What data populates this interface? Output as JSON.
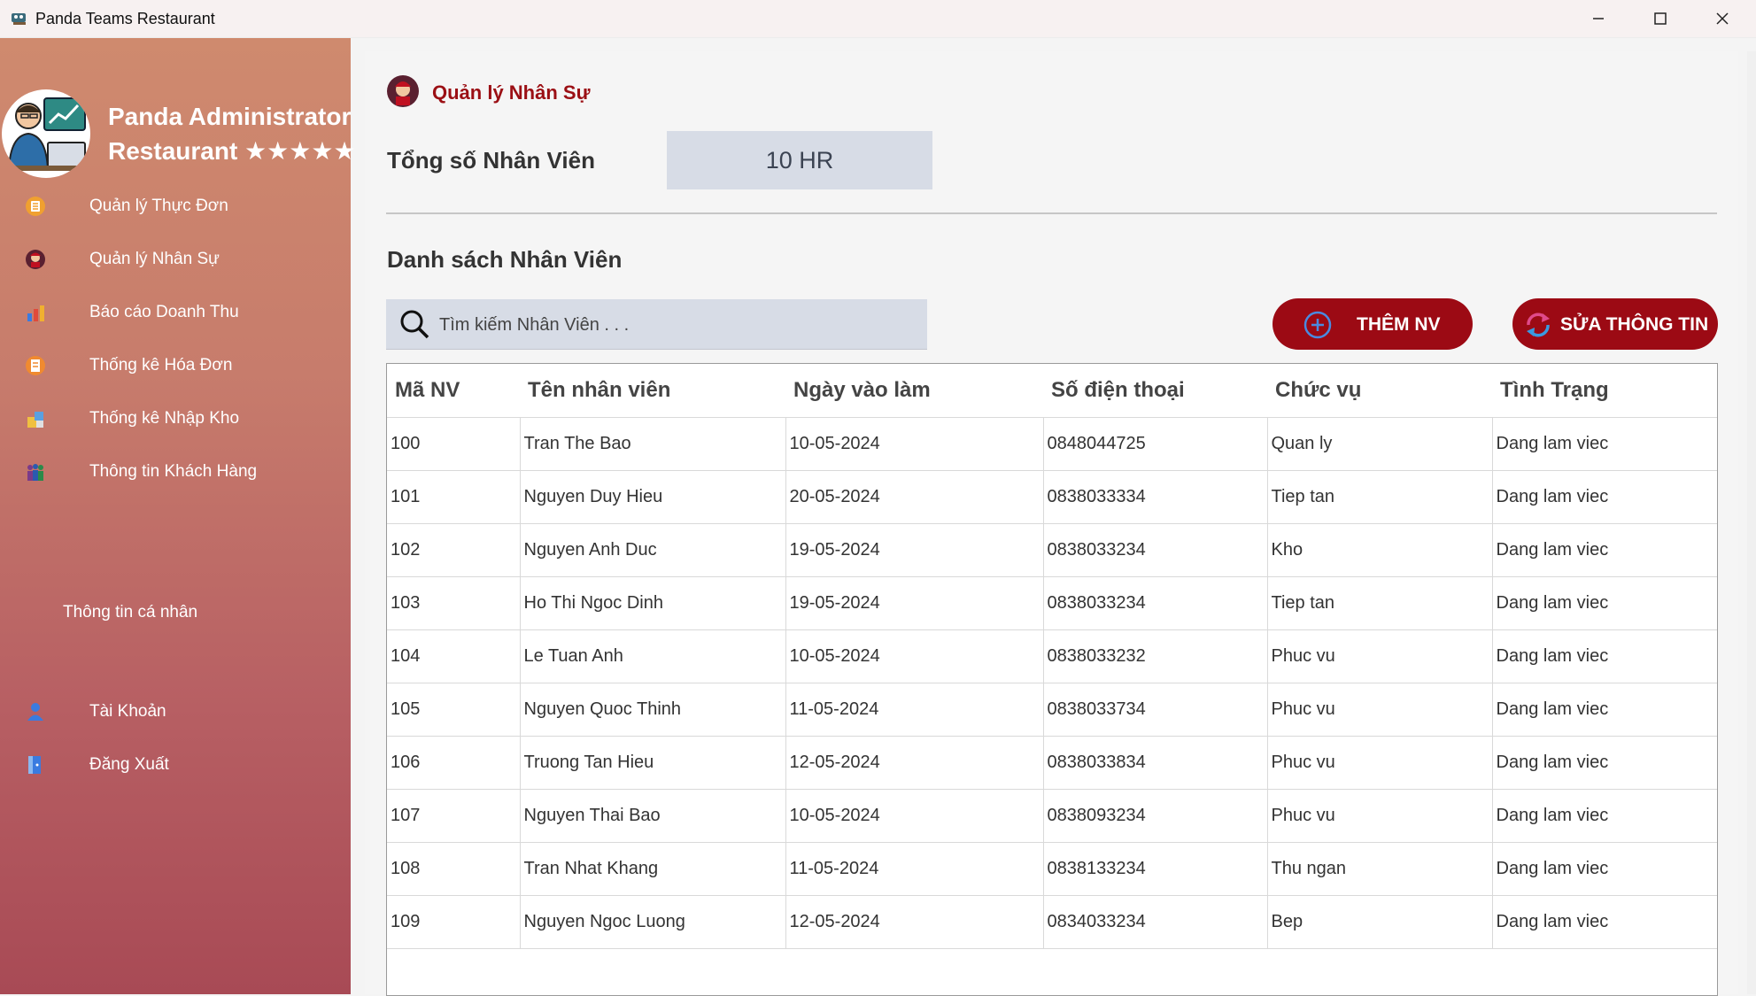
{
  "window": {
    "title": "Panda Teams Restaurant"
  },
  "sidebar": {
    "brand_line1": "Panda Administrator",
    "brand_line2": "Restaurant ★★★★★",
    "nav": [
      {
        "label": "Quản lý Thực Đơn",
        "icon": "menu-icon"
      },
      {
        "label": "Quản lý Nhân Sự",
        "icon": "staff-icon"
      },
      {
        "label": "Báo cáo Doanh Thu",
        "icon": "revenue-chart-icon"
      },
      {
        "label": "Thống kê Hóa Đơn",
        "icon": "invoice-icon"
      },
      {
        "label": "Thống kê Nhập Kho",
        "icon": "warehouse-icon"
      },
      {
        "label": "Thông tin Khách Hàng",
        "icon": "customers-icon"
      }
    ],
    "profile_label": "Thông tin cá nhân",
    "account": [
      {
        "label": "Tài Khoản",
        "icon": "user-icon"
      },
      {
        "label": "Đăng Xuất",
        "icon": "logout-icon"
      }
    ]
  },
  "main": {
    "page_title": "Quản lý Nhân Sự",
    "total_label": "Tổng số Nhân Viên",
    "total_value": "10 HR",
    "list_title": "Danh sách Nhân Viên",
    "search_placeholder": "Tìm kiếm Nhân Viên . . .",
    "add_button": "THÊM NV",
    "edit_button": "SỬA THÔNG TIN"
  },
  "table": {
    "columns": [
      "Mã NV",
      "Tên nhân viên",
      "Ngày vào làm",
      "Số điện thoại",
      "Chức vụ",
      "Tình Trạng"
    ],
    "rows": [
      [
        "100",
        "Tran The Bao",
        "10-05-2024",
        "0848044725",
        "Quan ly",
        "Dang lam viec"
      ],
      [
        "101",
        "Nguyen Duy Hieu",
        "20-05-2024",
        "0838033334",
        "Tiep tan",
        "Dang lam viec"
      ],
      [
        "102",
        "Nguyen Anh Duc",
        "19-05-2024",
        "0838033234",
        "Kho",
        "Dang lam viec"
      ],
      [
        "103",
        "Ho Thi Ngoc Dinh",
        "19-05-2024",
        "0838033234",
        "Tiep tan",
        "Dang lam viec"
      ],
      [
        "104",
        "Le Tuan Anh",
        "10-05-2024",
        "0838033232",
        "Phuc vu",
        "Dang lam viec"
      ],
      [
        "105",
        "Nguyen Quoc Thinh",
        "11-05-2024",
        "0838033734",
        "Phuc vu",
        "Dang lam viec"
      ],
      [
        "106",
        "Truong Tan Hieu",
        "12-05-2024",
        "0838033834",
        "Phuc vu",
        "Dang lam viec"
      ],
      [
        "107",
        "Nguyen Thai Bao",
        "10-05-2024",
        "0838093234",
        "Phuc vu",
        "Dang lam viec"
      ],
      [
        "108",
        "Tran Nhat Khang",
        "11-05-2024",
        "0838133234",
        "Thu ngan",
        "Dang lam viec"
      ],
      [
        "109",
        "Nguyen Ngoc Luong",
        "12-05-2024",
        "0834033234",
        "Bep",
        "Dang lam viec"
      ]
    ]
  },
  "colors": {
    "accent": "#9c0a14",
    "sidebar_top": "#cf8a6e",
    "sidebar_bottom": "#a84a55",
    "input_bg": "#d7dce6"
  }
}
